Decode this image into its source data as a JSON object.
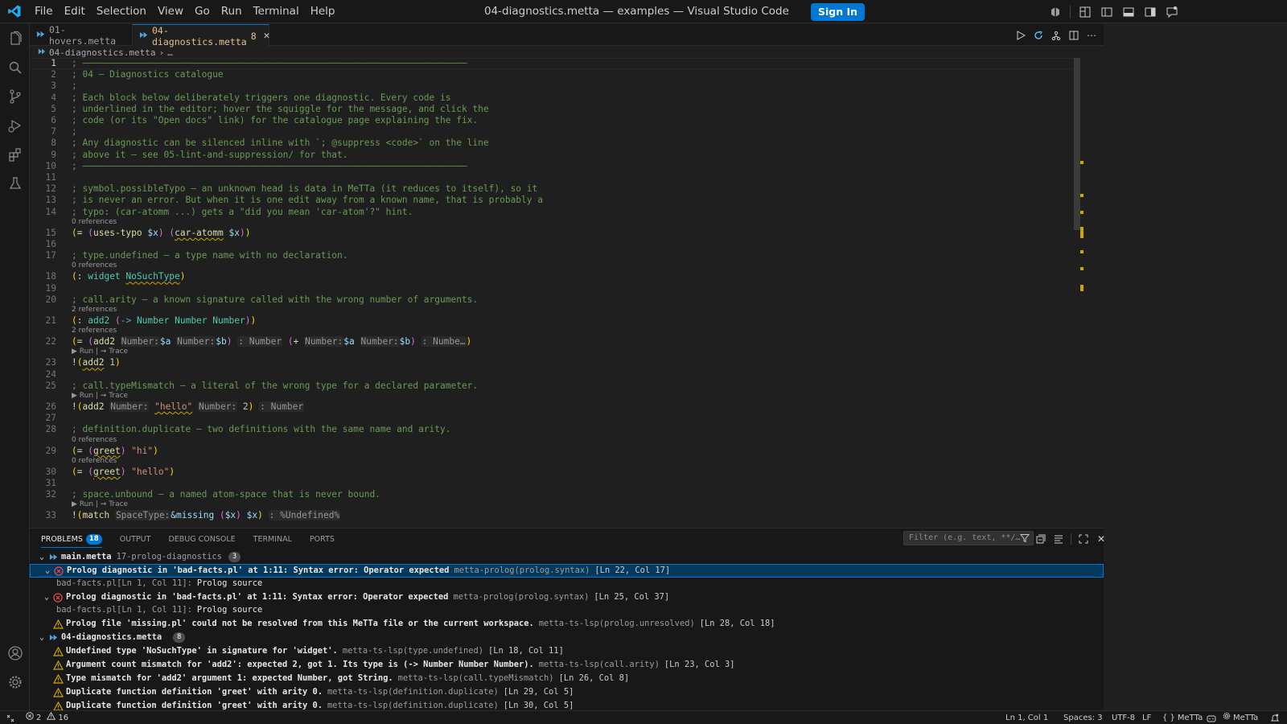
{
  "window": {
    "title": "04-diagnostics.metta — examples — Visual Studio Code",
    "sign_in": "Sign In"
  },
  "menu": [
    "File",
    "Edit",
    "Selection",
    "View",
    "Go",
    "Run",
    "Terminal",
    "Help"
  ],
  "tabs": [
    {
      "label": "01-hovers.metta"
    },
    {
      "label": "04-diagnostics.metta",
      "badge": "8",
      "active": true
    }
  ],
  "breadcrumb": {
    "file": "04-diagnostics.metta",
    "rest": "…"
  },
  "editor": {
    "lines": [
      {
        "n": "1",
        "html": "<span class=\"cmt\">; ———————————————————————————————————————————————————————————————————————</span>"
      },
      {
        "n": "2",
        "html": "<span class=\"cmt\">; 04 — Diagnostics catalogue</span>"
      },
      {
        "n": "3",
        "html": "<span class=\"cmt\">;</span>"
      },
      {
        "n": "4",
        "html": "<span class=\"cmt\">; Each block below deliberately triggers one diagnostic. Every code is</span>"
      },
      {
        "n": "5",
        "html": "<span class=\"cmt\">; underlined in the editor; hover the squiggle for the message, and click the</span>"
      },
      {
        "n": "6",
        "html": "<span class=\"cmt\">; code (or its \"Open docs\" link) for the catalogue page explaining the fix.</span>"
      },
      {
        "n": "7",
        "html": "<span class=\"cmt\">;</span>"
      },
      {
        "n": "8",
        "html": "<span class=\"cmt\">; Any diagnostic can be silenced inline with `; @suppress &lt;code&gt;` on the line</span>"
      },
      {
        "n": "9",
        "html": "<span class=\"cmt\">; above it — see 05-lint-and-suppression/ for that.</span>"
      },
      {
        "n": "10",
        "html": "<span class=\"cmt\">; ———————————————————————————————————————————————————————————————————————</span>"
      },
      {
        "n": "11",
        "html": ""
      },
      {
        "n": "12",
        "html": "<span class=\"cmt\">; symbol.possibleTypo — an unknown head is data in MeTTa (it reduces to itself), so it</span>"
      },
      {
        "n": "13",
        "html": "<span class=\"cmt\">; is never an error. But when it is one edit away from a known name, that is probably a</span>"
      },
      {
        "n": "14",
        "html": "<span class=\"cmt\">; typo: (car-atomm ...) gets a \"did you mean 'car-atom'?\" hint.</span>"
      },
      {
        "n": "15",
        "lens": "0 references",
        "html": "<span class=\"par\">(</span><span class=\"fn\">=</span> <span class=\"par2\">(</span><span class=\"fn\">uses-typo</span> <span class=\"var\">$x</span><span class=\"par2\">)</span> <span class=\"par2\">(</span><span class=\"fn squig\">car-atomm</span> <span class=\"var\">$x</span><span class=\"par2\">)</span><span class=\"par\">)</span>"
      },
      {
        "n": "16",
        "html": ""
      },
      {
        "n": "17",
        "html": "<span class=\"cmt\">; type.undefined — a type name with no declaration.</span>"
      },
      {
        "n": "18",
        "lens": "0 references",
        "html": "<span class=\"par\">(</span><span class=\"fn\">:</span> <span class=\"typ\">widget</span> <span class=\"typ squig\">NoSuchType</span><span class=\"par\">)</span>"
      },
      {
        "n": "19",
        "html": ""
      },
      {
        "n": "20",
        "html": "<span class=\"cmt\">; call.arity — a known signature called with the wrong number of arguments.</span>"
      },
      {
        "n": "21",
        "lens": "2 references",
        "html": "<span class=\"par\">(</span><span class=\"fn\">:</span> <span class=\"typ\">add2</span> <span class=\"par2\">(</span><span class=\"kw\">-&gt;</span> <span class=\"typ\">Number</span> <span class=\"typ\">Number</span> <span class=\"typ\">Number</span><span class=\"par2\">)</span><span class=\"par\">)</span>"
      },
      {
        "n": "22",
        "lens": "2 references",
        "html": "<span class=\"par\">(</span><span class=\"fn\">=</span> <span class=\"par2\">(</span><span class=\"fn\">add2</span> <span class=\"hint\">Number:</span><span class=\"var\">$a</span> <span class=\"hint\">Number:</span><span class=\"var\">$b</span><span class=\"par2\">)</span> <span class=\"hint\">: Number</span> <span class=\"par2\">(</span><span class=\"fn\">+</span> <span class=\"hint\">Number:</span><span class=\"var\">$a</span> <span class=\"hint\">Number:</span><span class=\"var\">$b</span><span class=\"par2\">)</span> <span class=\"hint\">: Numbe…</span><span class=\"par\">)</span>"
      },
      {
        "n": "23",
        "lens": "▶ Run | ⇝ Trace",
        "html": "<span class=\"fn\">!</span><span class=\"par\">(</span><span class=\"fn squig\">add2</span> <span class=\"num\">1</span><span class=\"par\">)</span>"
      },
      {
        "n": "24",
        "html": ""
      },
      {
        "n": "25",
        "html": "<span class=\"cmt\">; call.typeMismatch — a literal of the wrong type for a declared parameter.</span>"
      },
      {
        "n": "26",
        "lens": "▶ Run | ⇝ Trace",
        "html": "<span class=\"fn\">!</span><span class=\"par\">(</span><span class=\"fn\">add2</span> <span class=\"hint\">Number:</span> <span class=\"str squig\">\"hello\"</span> <span class=\"hint\">Number:</span> <span class=\"num\">2</span><span class=\"par\">)</span> <span class=\"hint\">: Number</span>"
      },
      {
        "n": "27",
        "html": ""
      },
      {
        "n": "28",
        "html": "<span class=\"cmt\">; definition.duplicate — two definitions with the same name and arity.</span>"
      },
      {
        "n": "29",
        "lens": "0 references",
        "html": "<span class=\"par\">(</span><span class=\"fn\">=</span> <span class=\"par2\">(</span><span class=\"fn squig\">greet</span><span class=\"par2\">)</span> <span class=\"str\">\"hi\"</span><span class=\"par\">)</span>"
      },
      {
        "n": "30",
        "lens": "0 references",
        "html": "<span class=\"par\">(</span><span class=\"fn\">=</span> <span class=\"par2\">(</span><span class=\"fn squig\">greet</span><span class=\"par2\">)</span> <span class=\"str\">\"hello\"</span><span class=\"par\">)</span>"
      },
      {
        "n": "31",
        "html": ""
      },
      {
        "n": "32",
        "html": "<span class=\"cmt\">; space.unbound — a named atom-space that is never bound.</span>"
      },
      {
        "n": "33",
        "lens": "▶ Run | ⇝ Trace",
        "html": "<span class=\"fn\">!</span><span class=\"par\">(</span><span class=\"fn\">match</span> <span class=\"hint\">SpaceType:</span><span class=\"var\">&amp;missing</span> <span class=\"par2\">(</span><span class=\"var\">$x</span><span class=\"par2\">)</span> <span class=\"var\">$x</span><span class=\"par\">)</span> <span class=\"hint\">: %Undefined%</span>"
      }
    ]
  },
  "panel": {
    "tabs": [
      {
        "label": "PROBLEMS",
        "badge": "18",
        "active": true
      },
      {
        "label": "OUTPUT"
      },
      {
        "label": "DEBUG CONSOLE"
      },
      {
        "label": "TERMINAL"
      },
      {
        "label": "PORTS"
      }
    ],
    "filter_placeholder": "Filter (e.g. text, **/…",
    "groups": [
      {
        "file": "main.metta",
        "path": "17-prolog-diagnostics",
        "count": "3",
        "items": [
          {
            "severity": "error",
            "expanded": true,
            "selected": true,
            "message": "Prolog diagnostic in 'bad-facts.pl' at 1:11: Syntax error: Operator expected",
            "source": "metta-prolog(prolog.syntax)",
            "pos": "[Ln 22, Col 17]",
            "related": {
              "loc": "bad-facts.pl[Ln 1, Col 11]:",
              "text": "Prolog source"
            }
          },
          {
            "severity": "error",
            "expanded": true,
            "message": "Prolog diagnostic in 'bad-facts.pl' at 1:11: Syntax error: Operator expected",
            "source": "metta-prolog(prolog.syntax)",
            "pos": "[Ln 25, Col 37]",
            "related": {
              "loc": "bad-facts.pl[Ln 1, Col 11]:",
              "text": "Prolog source"
            }
          },
          {
            "severity": "warning",
            "message": "Prolog file 'missing.pl' could not be resolved from this MeTTa file or the current workspace.",
            "source": "metta-ts-lsp(prolog.unresolved)",
            "pos": "[Ln 28, Col 18]"
          }
        ]
      },
      {
        "file": "04-diagnostics.metta",
        "path": "",
        "count": "8",
        "items": [
          {
            "severity": "warning",
            "message": "Undefined type 'NoSuchType' in signature for 'widget'.",
            "source": "metta-ts-lsp(type.undefined)",
            "pos": "[Ln 18, Col 11]"
          },
          {
            "severity": "warning",
            "message": "Argument count mismatch for 'add2': expected 2, got 1. Its type is (-> Number Number Number).",
            "source": "metta-ts-lsp(call.arity)",
            "pos": "[Ln 23, Col 3]"
          },
          {
            "severity": "warning",
            "message": "Type mismatch for 'add2' argument 1: expected Number, got String.",
            "source": "metta-ts-lsp(call.typeMismatch)",
            "pos": "[Ln 26, Col 8]"
          },
          {
            "severity": "warning",
            "message": "Duplicate function definition 'greet' with arity 0.",
            "source": "metta-ts-lsp(definition.duplicate)",
            "pos": "[Ln 29, Col 5]"
          },
          {
            "severity": "warning",
            "message": "Duplicate function definition 'greet' with arity 0.",
            "source": "metta-ts-lsp(definition.duplicate)",
            "pos": "[Ln 30, Col 5]"
          }
        ]
      }
    ]
  },
  "statusbar": {
    "errors": "2",
    "warnings": "16",
    "position": "Ln 1, Col 1",
    "spaces": "Spaces: 3",
    "encoding": "UTF-8",
    "eol": "LF",
    "language": "MeTTa",
    "lsp": "MeTTa"
  },
  "colors": {
    "accent": "#0078d4",
    "warning": "#cca700",
    "error": "#f14c4c"
  }
}
